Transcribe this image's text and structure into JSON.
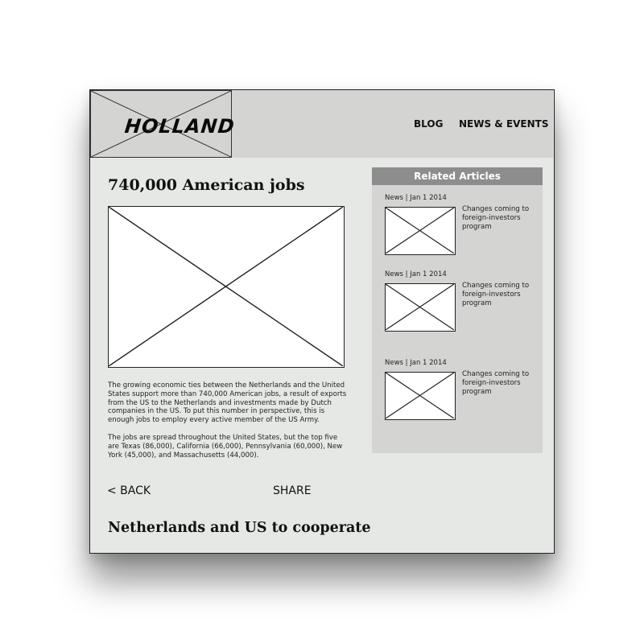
{
  "header": {
    "logo_text": "HOLLAND",
    "nav": [
      {
        "label": "BLOG"
      },
      {
        "label": "NEWS & EVENTS"
      }
    ]
  },
  "main": {
    "title": "740,000 American jobs",
    "paragraphs": [
      "The growing economic ties between the Netherlands and the United States support more than 740,000 American jobs, a result of exports from the US to the Netherlands and investments made by Dutch companies in the US. To put this number in perspective, this is enough jobs to employ every active member of the US Army.",
      "The jobs are spread throughout the United States, but the top five are Texas (86,000), California (66,000), Pennsylvania (60,000), New York (45,000), and Massachusetts (44,000)."
    ],
    "back_label": "< BACK",
    "share_label": "SHARE",
    "next_article_title": "Netherlands and US to cooperate"
  },
  "related": {
    "heading": "Related Articles",
    "articles": [
      {
        "meta": "News | Jan 1 2014",
        "title": "Changes coming to foreign-investors program"
      },
      {
        "meta": "News | Jan 1 2014",
        "title": "Changes coming to foreign-investors program"
      },
      {
        "meta": "News | Jan 1 2014",
        "title": "Changes coming to foreign-investors program"
      }
    ]
  }
}
